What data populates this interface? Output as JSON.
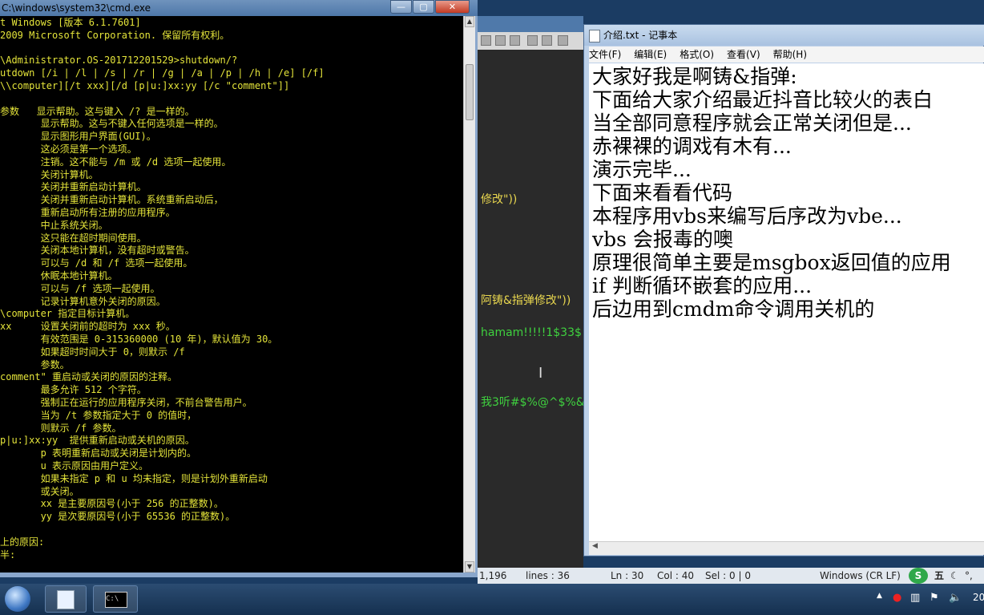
{
  "cmd": {
    "title": "C:\\windows\\system32\\cmd.exe",
    "lines": [
      "t Windows [版本 6.1.7601]",
      "2009 Microsoft Corporation. 保留所有权利。",
      "",
      "\\Administrator.OS-201712201529>shutdown/?",
      "utdown [/i | /l | /s | /r | /g | /a | /p | /h | /e] [/f]",
      "\\\\computer][/t xxx][/d [p|u:]xx:yy [/c \"comment\"]]",
      "",
      "参数   显示帮助。这与键入 /? 是一样的。",
      "       显示帮助。这与不键入任何选项是一样的。",
      "       显示图形用户界面(GUI)。",
      "       这必须是第一个选项。",
      "       注销。这不能与 /m 或 /d 选项一起使用。",
      "       关闭计算机。",
      "       关闭并重新启动计算机。",
      "       关闭并重新启动计算机。系统重新启动后，",
      "       重新启动所有注册的应用程序。",
      "       中止系统关闭。",
      "       这只能在超时期间使用。",
      "       关闭本地计算机，没有超时或警告。",
      "       可以与 /d 和 /f 选项一起使用。",
      "       休眠本地计算机。",
      "       可以与 /f 选项一起使用。",
      "       记录计算机意外关闭的原因。",
      "\\computer 指定目标计算机。",
      "xx     设置关闭前的超时为 xxx 秒。",
      "       有效范围是 0-315360000 (10 年)，默认值为 30。",
      "       如果超时时间大于 0，则默示 /f",
      "       参数。",
      "comment\" 重启动或关闭的原因的注释。",
      "       最多允许 512 个字符。",
      "       强制正在运行的应用程序关闭，不前台警告用户。",
      "       当为 /t 参数指定大于 0 的值时，",
      "       则默示 /f 参数。",
      "p|u:]xx:yy  提供重新启动或关机的原因。",
      "       p 表明重新启动或关闭是计划内的。",
      "       u 表示原因由用户定义。",
      "       如果未指定 p 和 u 均未指定，则是计划外重新启动",
      "       或关闭。",
      "       xx 是主要原因号(小于 256 的正整数)。",
      "       yy 是次要原因号(小于 65536 的正整数)。",
      "",
      "上的原因:",
      "半:"
    ]
  },
  "editor": {
    "lines": [
      {
        "text": "修改\"))",
        "color": "yellow"
      },
      {
        "text": "阿铸&指弹修改\"))",
        "color": "yellow"
      },
      {
        "text": "hamam!!!!!1$33$",
        "color": "green"
      },
      {
        "text": "我3听#$%@^$%&",
        "color": "green"
      }
    ]
  },
  "notepad": {
    "title": "介绍.txt - 记事本",
    "menu": [
      "文件(F)",
      "编辑(E)",
      "格式(O)",
      "查看(V)",
      "帮助(H)"
    ],
    "lines": [
      "大家好我是啊铸&指弹:",
      "下面给大家介绍最近抖音比较火的表白",
      "当全部同意程序就会正常关闭但是...",
      "赤裸裸的调戏有木有...",
      "演示完毕...",
      "下面来看看代码",
      "本程序用vbs来编写后序改为vbe...",
      "vbs 会报毒的噢",
      "原理很简单主要是msgbox返回值的应用",
      "if 判断循环嵌套的应用...",
      "后边用到cmdm命令调用关机的"
    ]
  },
  "status": {
    "length": "1,196",
    "lines": "lines : 36",
    "ln": "Ln : 30",
    "col": "Col : 40",
    "sel": "Sel : 0 | 0",
    "eol": "Windows (CR LF)",
    "ime": "五"
  },
  "taskbar": {
    "clock": "20"
  }
}
